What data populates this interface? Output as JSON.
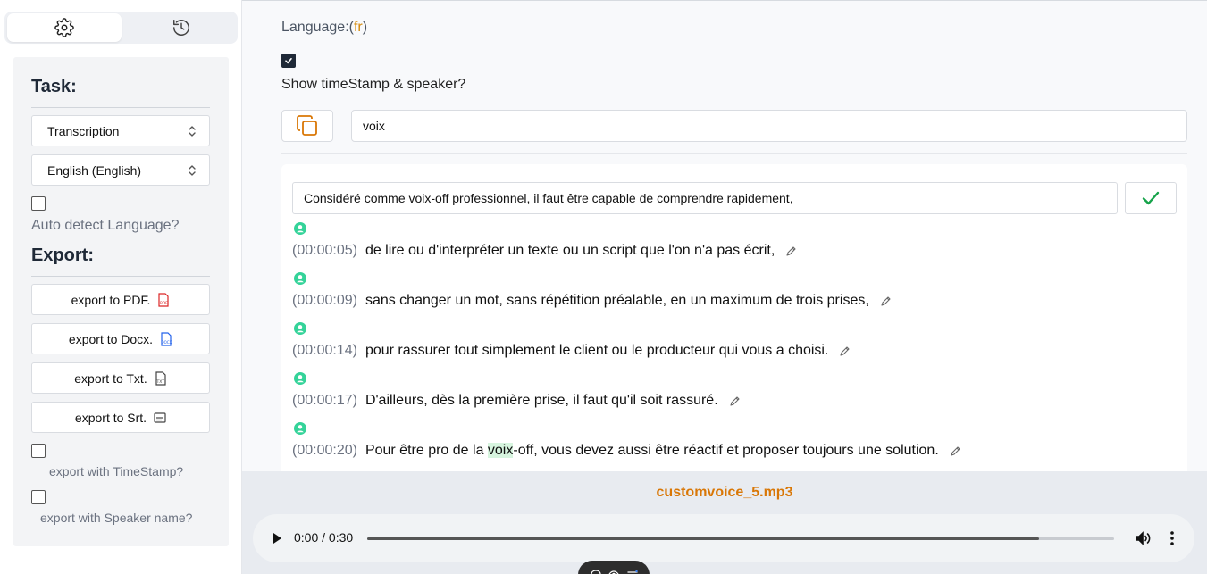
{
  "sidebar": {
    "tabs": [
      {
        "icon": "gear-icon"
      },
      {
        "icon": "history-icon"
      }
    ],
    "task_heading": "Task:",
    "task_select": "Transcription",
    "language_select": "English (English)",
    "auto_detect_label": "Auto detect Language?",
    "export_heading": "Export:",
    "export_buttons": [
      {
        "label": "export to PDF.",
        "icon": "pdf-file-icon"
      },
      {
        "label": "export to Docx.",
        "icon": "docx-file-icon"
      },
      {
        "label": "export to Txt.",
        "icon": "txt-file-icon"
      },
      {
        "label": "export to Srt.",
        "icon": "subtitle-icon"
      }
    ],
    "export_timestamp_label": "export with TimeStamp?",
    "export_speaker_label": "export with Speaker name?"
  },
  "main": {
    "language_prefix": "Language:(",
    "language_code": "fr",
    "language_suffix": ")",
    "show_timestamp_label": "Show timeStamp & speaker?",
    "search_value": "voix",
    "edit_value": "Considéré comme voix-off professionnel, il faut être capable de comprendre rapidement,",
    "segments": [
      {
        "time": "(00:00:05)",
        "text": "de lire ou d'interpréter un texte ou un script que l'on n'a pas écrit,"
      },
      {
        "time": "(00:00:09)",
        "text": "sans changer un mot, sans répétition préalable, en un maximum de trois prises,"
      },
      {
        "time": "(00:00:14)",
        "text": "pour rassurer tout simplement le client ou le producteur qui vous a choisi."
      },
      {
        "time": "(00:00:17)",
        "text": "D'ailleurs, dès la première prise, il faut qu'il soit rassuré."
      },
      {
        "time": "(00:00:20)",
        "text_before": "Pour être pro de la ",
        "text_highlight": "voix",
        "text_after": "-off, vous devez aussi être réactif et proposer toujours une solution."
      }
    ]
  },
  "player": {
    "filename": "customvoice_5.mp3",
    "time": "0:00 / 0:30",
    "buffered_fraction": 0.9
  },
  "colors": {
    "accent": "#d97706",
    "speaker_icon": "#34d399",
    "check": "#16a34a",
    "highlight": "#d7f5df"
  }
}
